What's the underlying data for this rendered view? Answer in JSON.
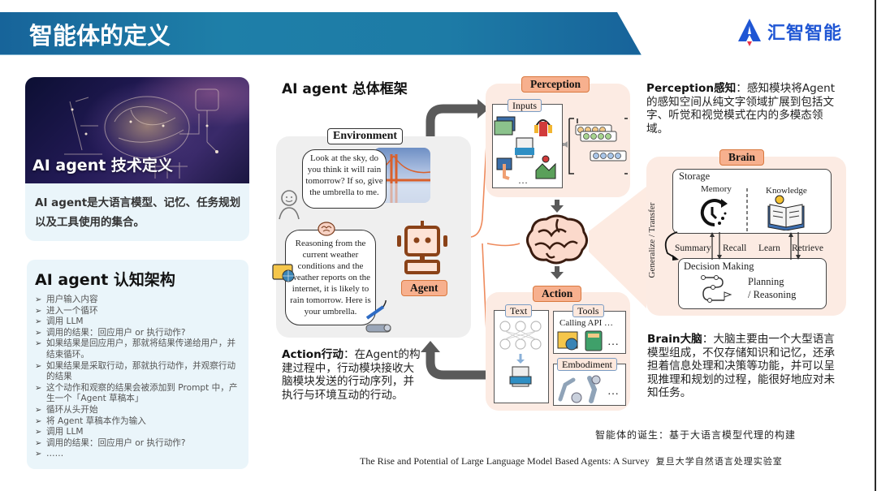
{
  "header": {
    "title": "智能体的定义",
    "logo_text": "汇智智能",
    "logo_icon": "rocket-a-icon",
    "colors": {
      "banner": "#1d7ba6",
      "logo": "#1f56d4",
      "logo_flame": "#e8334a"
    }
  },
  "definition_card": {
    "title": "AI agent 技术定义",
    "body": "AI agent是大语言模型、记忆、任务规划以及工具使用的集合。"
  },
  "architecture_card": {
    "title": "AI agent 认知架构",
    "bullet_icon": "arrow-right-icon",
    "items": [
      "用户输入内容",
      "进入一个循环",
      "调用 LLM",
      "调用的结果：回应用户 or 执行动作?",
      "如果结果是回应用户，那就将结果传递给用户，并结束循环。",
      "如果结果是采取行动，那就执行动作，并观察行动的结果",
      "这个动作和观察的结果会被添加到 Prompt 中，产生一个「Agent 草稿本」",
      "循环从头开始",
      "将 Agent 草稿本作为输入",
      "调用 LLM",
      "调用的结果：回应用户 or 执行动作?",
      "……"
    ]
  },
  "diagram": {
    "title": "AI agent 总体框架",
    "environment": {
      "label": "Environment",
      "user_bubble": "Look at the sky, do you think it will rain tomorrow? If so, give the umbrella to me.",
      "agent_bubble": "Reasoning from the current weather conditions and the weather reports on the internet, it is likely to rain tomorrow. Here is your umbrella.",
      "agent_label": "Agent"
    },
    "perception": {
      "label": "Perception",
      "inputs_label": "Inputs",
      "ellipsis": "…",
      "tokens_ellipsis": "…"
    },
    "action": {
      "label": "Action",
      "text_label": "Text",
      "tools_label": "Tools",
      "tools_caption": "Calling API …",
      "embodiment_label": "Embodiment",
      "ellipsis": "…"
    },
    "brain": {
      "label": "Brain",
      "storage_label": "Storage",
      "memory_label": "Memory",
      "knowledge_label": "Knowledge",
      "summary_label": "Summary",
      "recall_label": "Recall",
      "learn_label": "Learn",
      "retrieve_label": "Retrieve",
      "generalize_label": "Generalize / Transfer",
      "decision_label": "Decision Making",
      "planning_label": "Planning",
      "reasoning_label": "/ Reasoning"
    }
  },
  "descriptions": {
    "perception": {
      "head": "Perception感知",
      "body": "：感知模块将Agent的感知空间从纯文字领域扩展到包括文字、听觉和视觉模式在内的多模态领域。"
    },
    "brain": {
      "head": "Brain大脑",
      "body": "：大脑主要由一个大型语言模型组成，不仅存储知识和记忆，还承担着信息处理和决策等功能，并可以呈现推理和规划的过程，能很好地应对未知任务。"
    },
    "action": {
      "head": "Action行动",
      "body": "：在Agent的构建过程中，行动模块接收大脑模块发送的行动序列，并执行与环境互动的行动。"
    }
  },
  "footer": {
    "cn_title": "智能体的诞生：基于大语言模型代理的构建",
    "en_title": "The Rise and Potential of Large Language Model Based Agents: A Survey",
    "org": "复旦大学自然语言处理实验室"
  }
}
